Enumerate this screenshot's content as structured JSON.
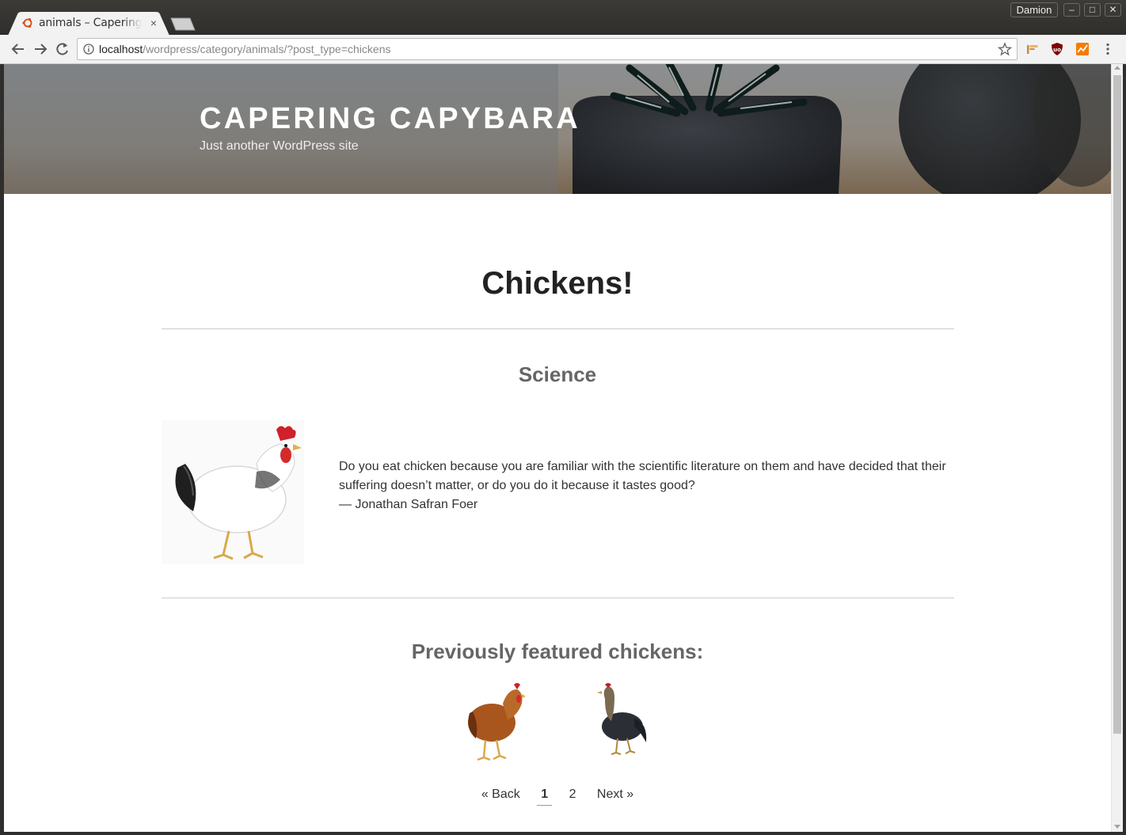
{
  "browser": {
    "tab_title": "animals – Capering Capybara",
    "tab_close": "×",
    "user_name": "Damion",
    "window_buttons": [
      "–",
      "□",
      "✕"
    ],
    "url_host": "localhost",
    "url_path": "/wordpress/category/animals/?post_type=chickens",
    "icons": [
      "back-icon",
      "forward-icon",
      "reload-icon",
      "info-icon",
      "bookmark-star-icon",
      "extension-icon",
      "ublock-icon",
      "analytics-icon",
      "menu-icon"
    ]
  },
  "site": {
    "title": "CAPERING CAPYBARA",
    "description": "Just another WordPress site"
  },
  "main": {
    "page_title": "Chickens!",
    "section_title": "Science",
    "quote_line": "Do you eat chicken because you are familiar with the scientific literature on them and have decided that their suffering doesn’t matter, or do you do it because it tastes good?",
    "quote_author": "— Jonathan Safran Foer",
    "previous_title": "Previously featured chickens:"
  },
  "pagination": {
    "back": "« Back",
    "pages": [
      "1",
      "2"
    ],
    "current": "1",
    "next": "Next »"
  },
  "colors": {
    "chrome_dark": "#2f2e2c",
    "toolbar": "#f2f2f2",
    "text": "#222222",
    "muted_heading": "#666666"
  }
}
